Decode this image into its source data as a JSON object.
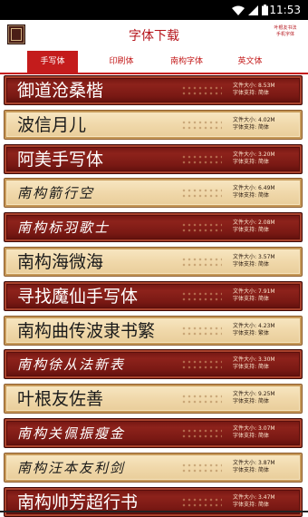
{
  "status_bar": {
    "time": "11:53"
  },
  "header": {
    "title": "字体下载",
    "right_link_line1": "叶根友书法",
    "right_link_line2": "手机字体"
  },
  "tabs": [
    {
      "label": "手写体",
      "active": true
    },
    {
      "label": "印刷体",
      "active": false
    },
    {
      "label": "南构字体",
      "active": false
    },
    {
      "label": "英文体",
      "active": false
    }
  ],
  "size_prefix": "文件大小:",
  "support_prefix": "字体支持:",
  "fonts": [
    {
      "name": "御道沧桑楷",
      "size": "8.53M",
      "support": "简体",
      "style": "red"
    },
    {
      "name": "波信月儿",
      "size": "4.02M",
      "support": "简体",
      "style": "beige"
    },
    {
      "name": "阿美手写体",
      "size": "3.20M",
      "support": "简体",
      "style": "red"
    },
    {
      "name": "南构箭行空",
      "size": "6.49M",
      "support": "简体",
      "style": "beige"
    },
    {
      "name": "南构标羽歌士",
      "size": "2.08M",
      "support": "简体",
      "style": "red"
    },
    {
      "name": "南构海微海",
      "size": "3.57M",
      "support": "简体",
      "style": "beige"
    },
    {
      "name": "寻找魔仙手写体",
      "size": "7.91M",
      "support": "简体",
      "style": "red"
    },
    {
      "name": "南构曲传波隶书繁",
      "size": "4.23M",
      "support": "繁体",
      "style": "beige"
    },
    {
      "name": "南构徐从法新表",
      "size": "3.30M",
      "support": "简体",
      "style": "red"
    },
    {
      "name": "叶根友佐善",
      "size": "9.25M",
      "support": "简体",
      "style": "beige"
    },
    {
      "name": "南构关佩振瘦金",
      "size": "3.07M",
      "support": "简体",
      "style": "red"
    },
    {
      "name": "南构汪本友利剑",
      "size": "3.87M",
      "support": "简体",
      "style": "beige"
    },
    {
      "name": "南构帅芳超行书",
      "size": "3.47M",
      "support": "简体",
      "style": "red"
    }
  ]
}
